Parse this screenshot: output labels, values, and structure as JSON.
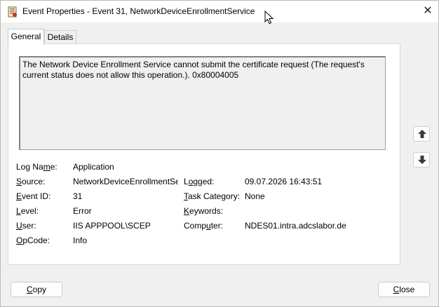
{
  "window": {
    "title": "Event Properties - Event 31, NetworkDeviceEnrollmentService"
  },
  "tabs": [
    {
      "label": "General",
      "active": true
    },
    {
      "label": "Details",
      "active": false
    }
  ],
  "event": {
    "description": "The Network Device Enrollment Service cannot submit the certificate request (The request's current status does not allow this operation.).  0x80004005",
    "fields": {
      "log_name": {
        "label_pre": "Log Na",
        "label_u": "m",
        "label_post": "e:",
        "value": "Application"
      },
      "source": {
        "label_pre": "",
        "label_u": "S",
        "label_post": "ource:",
        "value": "NetworkDeviceEnrollmentService"
      },
      "event_id": {
        "label_pre": "",
        "label_u": "E",
        "label_post": "vent ID:",
        "value": "31"
      },
      "level": {
        "label_pre": "",
        "label_u": "L",
        "label_post": "evel:",
        "value": "Error"
      },
      "user": {
        "label_pre": "",
        "label_u": "U",
        "label_post": "ser:",
        "value": "IIS APPPOOL\\SCEP"
      },
      "opcode": {
        "label_pre": "",
        "label_u": "O",
        "label_post": "pCode:",
        "value": "Info"
      },
      "logged": {
        "label_pre": "L",
        "label_u": "o",
        "label_post": "gged:",
        "value": "09.07.2026 16:43:51"
      },
      "task_category": {
        "label_pre": "",
        "label_u": "T",
        "label_post": "ask Category:",
        "value": "None"
      },
      "keywords": {
        "label_pre": "",
        "label_u": "K",
        "label_post": "eywords:",
        "value": ""
      },
      "computer": {
        "label_pre": "Comp",
        "label_u": "u",
        "label_post": "ter:",
        "value": "NDES01.intra.adcslabor.de"
      }
    }
  },
  "buttons": {
    "copy": {
      "label_u": "C",
      "label_post": "opy"
    },
    "close": {
      "label_u": "C",
      "label_post": "lose"
    }
  },
  "icons": {
    "title": "event-log-icon",
    "close": "close-icon",
    "up": "arrow-up-icon",
    "down": "arrow-down-icon"
  }
}
